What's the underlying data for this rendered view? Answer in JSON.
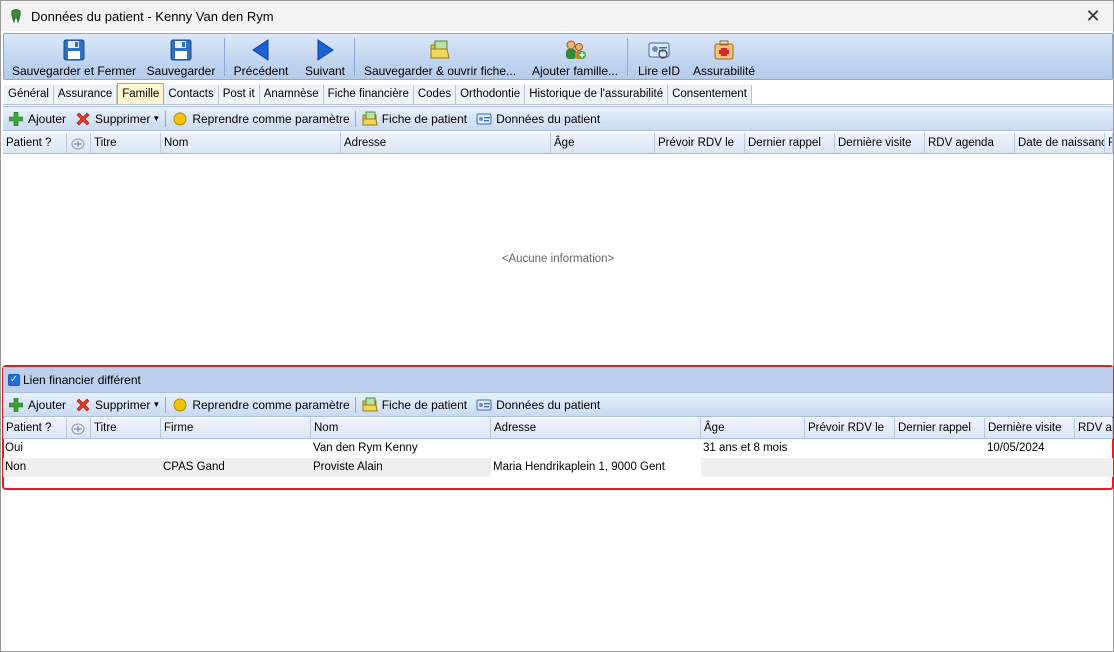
{
  "window": {
    "title": "Données du patient - Kenny Van den Rym"
  },
  "ribbon": {
    "buttons": [
      {
        "label": "Sauvegarder et Fermer"
      },
      {
        "label": "Sauvegarder"
      },
      {
        "label": "Précédent"
      },
      {
        "label": "Suivant"
      },
      {
        "label": "Sauvegarder & ouvrir fiche..."
      },
      {
        "label": "Ajouter famille..."
      },
      {
        "label": "Lire eID"
      },
      {
        "label": "Assurabilité"
      }
    ]
  },
  "tabs": [
    "Général",
    "Assurance",
    "Famille",
    "Contacts",
    "Post it",
    "Anamnèse",
    "Fiche financière",
    "Codes",
    "Orthodontie",
    "Historique de l'assurabilité",
    "Consentement"
  ],
  "active_tab": "Famille",
  "toolbar": {
    "add": "Ajouter",
    "delete": "Supprimer",
    "reprendre": "Reprendre comme paramètre",
    "fiche": "Fiche de patient",
    "donnees": "Données du patient"
  },
  "grid_top": {
    "columns": [
      "Patient ?",
      "",
      "Titre",
      "Nom",
      "Adresse",
      "Âge",
      "Prévoir RDV le",
      "Dernier rappel",
      "Dernière visite",
      "RDV agenda",
      "Date de naissance",
      "F"
    ],
    "empty_text": "<Aucune information>"
  },
  "financial": {
    "checkbox_label": "Lien financier différent",
    "checked": true
  },
  "grid_bottom": {
    "columns": [
      "Patient ?",
      "",
      "Titre",
      "Firme",
      "Nom",
      "Adresse",
      "Âge",
      "Prévoir RDV le",
      "Dernier rappel",
      "Dernière visite",
      "RDV ag"
    ],
    "rows": [
      {
        "patient": "Oui",
        "titre": "",
        "firme": "",
        "nom": "Van den Rym Kenny",
        "adresse": "",
        "age": "31 ans et 8 mois",
        "prevoir": "",
        "rappel": "",
        "visite": "10/05/2024",
        "rdv": ""
      },
      {
        "patient": "Non",
        "titre": "",
        "firme": "CPAS Gand",
        "nom": "Proviste Alain",
        "adresse": "Maria Hendrikaplein 1, 9000 Gent",
        "age": "",
        "prevoir": "",
        "rappel": "",
        "visite": "",
        "rdv": ""
      }
    ]
  },
  "colors": {
    "ribbon": "#c3d6f0",
    "active_tab": "#fff5cf",
    "highlight_frame": "#e02020"
  }
}
